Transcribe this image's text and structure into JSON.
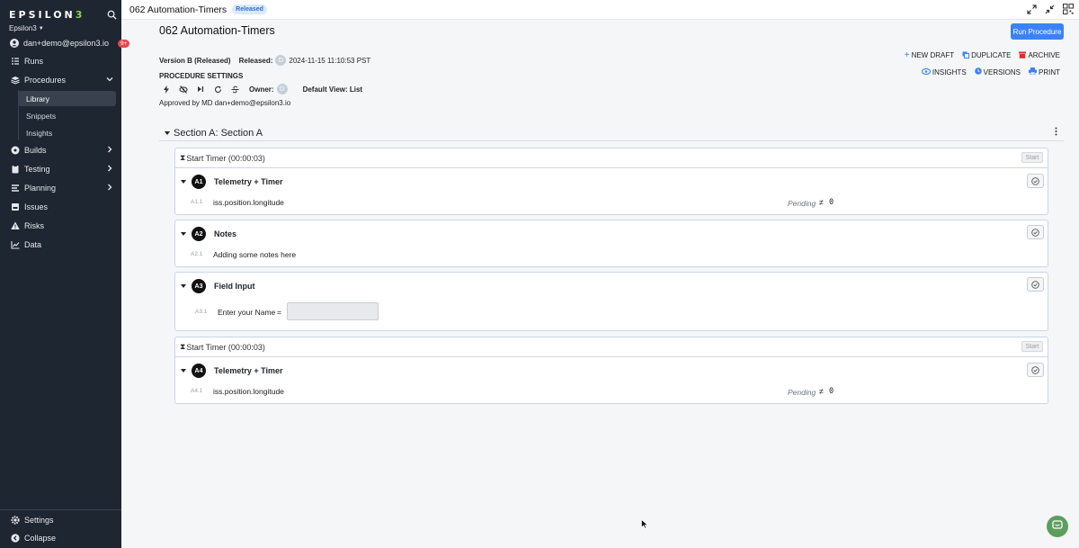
{
  "sidebar": {
    "logo_text": "EPSILON",
    "logo_accent": "3",
    "workspace": "Epsilon3",
    "user": "dan+demo@epsilon3.io",
    "notifications": "9+",
    "items": [
      {
        "label": "Runs",
        "icon": "runs-icon"
      },
      {
        "label": "Procedures",
        "icon": "procedures-icon"
      },
      {
        "label": "Builds",
        "icon": "builds-icon"
      },
      {
        "label": "Testing",
        "icon": "testing-icon"
      },
      {
        "label": "Planning",
        "icon": "planning-icon"
      },
      {
        "label": "Issues",
        "icon": "issues-icon"
      },
      {
        "label": "Risks",
        "icon": "risks-icon"
      },
      {
        "label": "Data",
        "icon": "data-icon"
      }
    ],
    "sub_items": [
      {
        "label": "Library",
        "active": true
      },
      {
        "label": "Snippets",
        "active": false
      },
      {
        "label": "Insights",
        "active": false
      }
    ],
    "footer": {
      "settings": "Settings",
      "collapse": "Collapse"
    }
  },
  "topbar": {
    "title": "062 Automation-Timers",
    "status_badge": "Released"
  },
  "header": {
    "title": "062 Automation-Timers",
    "run_button": "Run Procedure",
    "version": "Version B (Released)",
    "released_label": "Released:",
    "released_avatar": "D",
    "released_at": "2024-11-15 11:10:53 PST",
    "settings_heading": "PROCEDURE SETTINGS",
    "owner_label": "Owner:",
    "owner_avatar": "D",
    "default_view": "Default View: List",
    "approved_by": "Approved by MD dan+demo@epsilon3.io"
  },
  "actions": {
    "new_draft": "NEW DRAFT",
    "duplicate": "DUPLICATE",
    "archive": "ARCHIVE",
    "insights": "INSIGHTS",
    "versions": "VERSIONS",
    "print": "PRINT"
  },
  "section": {
    "title": "Section A: Section A"
  },
  "timers": [
    {
      "label": "Start Timer (00:00:03)",
      "button": "Start"
    },
    {
      "label": "Start Timer (00:00:03)",
      "button": "Start"
    }
  ],
  "steps": [
    {
      "badge": "A1",
      "title": "Telemetry + Timer",
      "sub_num": "A1.1",
      "text": "iss.position.longitude",
      "status": "Pending",
      "operator": "≠",
      "value": "0"
    },
    {
      "badge": "A2",
      "title": "Notes",
      "sub_num": "A2.1",
      "text": "Adding some notes here"
    },
    {
      "badge": "A3",
      "title": "Field Input",
      "sub_num": "A3.1",
      "text": "Enter your Name",
      "operator": "=",
      "input_value": ""
    },
    {
      "badge": "A4",
      "title": "Telemetry + Timer",
      "sub_num": "A4.1",
      "text": "iss.position.longitude",
      "status": "Pending",
      "operator": "≠",
      "value": "0"
    }
  ],
  "colors": {
    "sidebar_bg": "#1e2631",
    "primary": "#3b82f6",
    "logo_accent": "#8fd14f",
    "archive_red": "#d93025",
    "chat": "#5d9e5f"
  }
}
